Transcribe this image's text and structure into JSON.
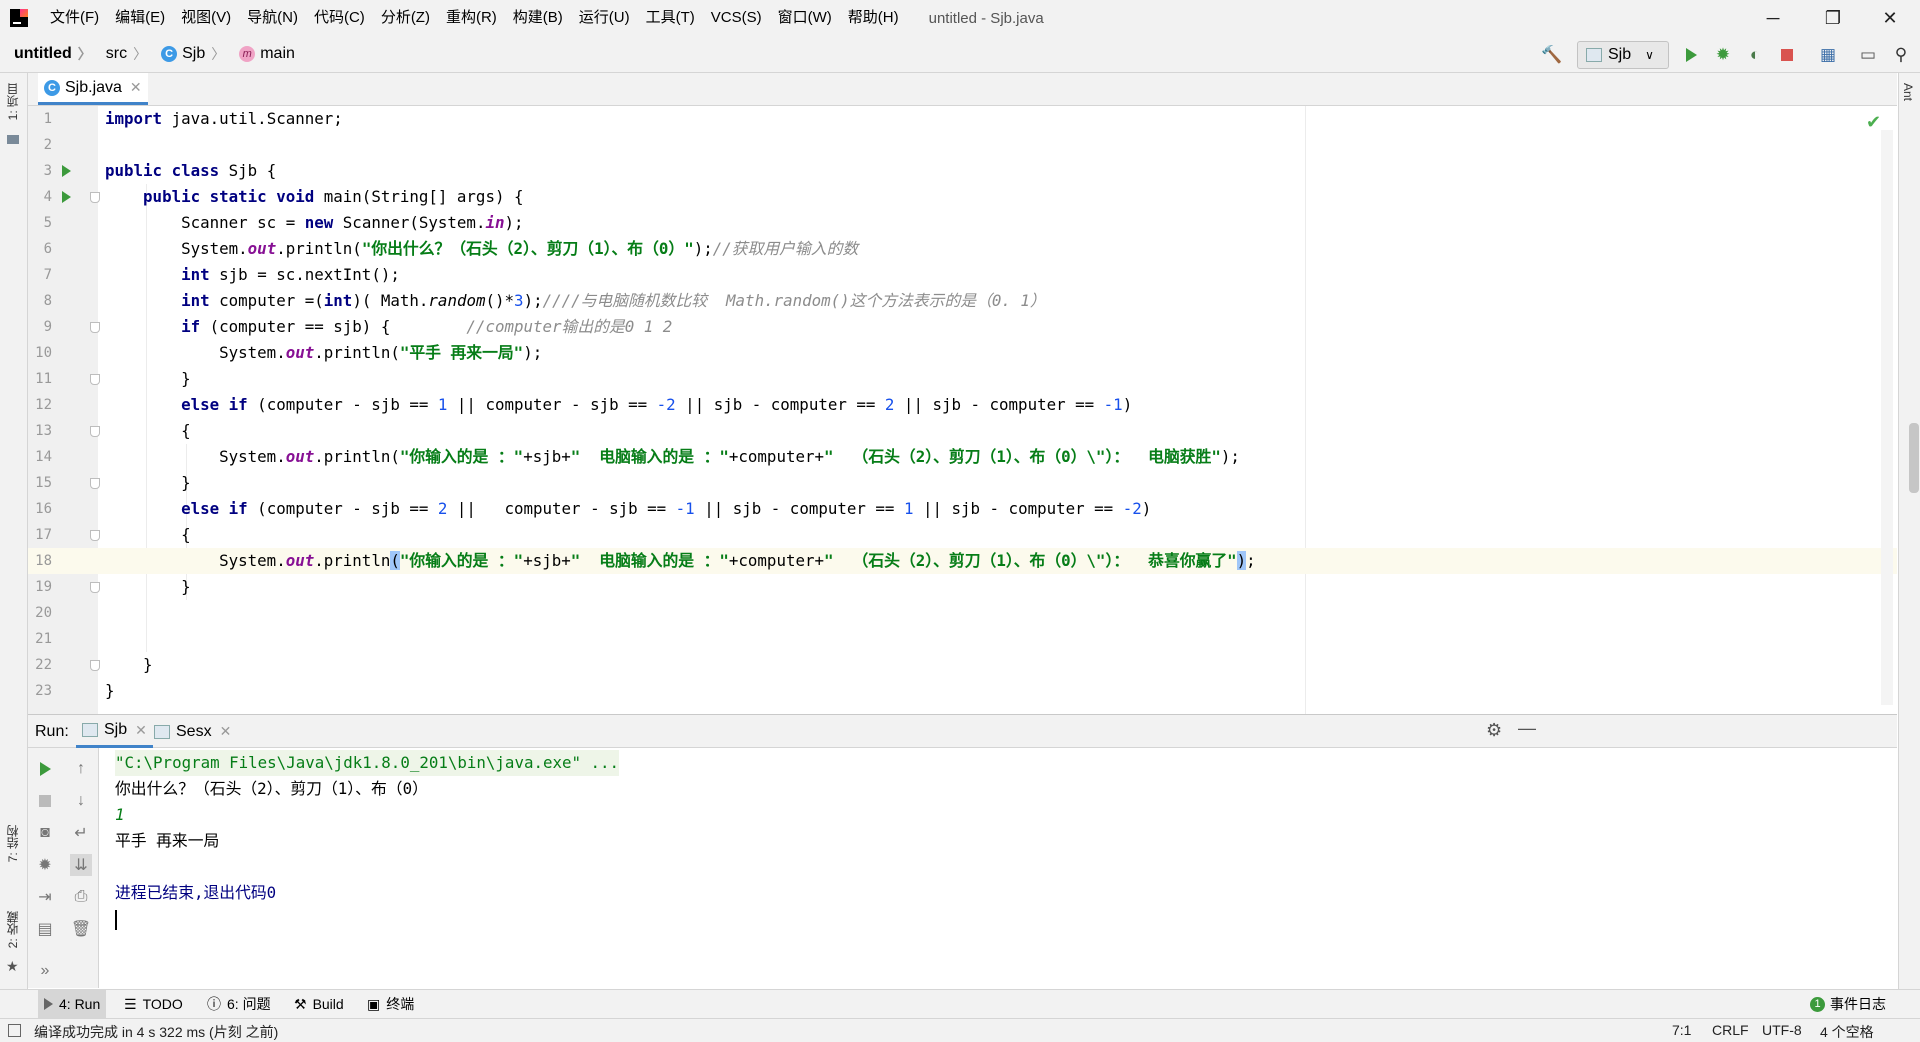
{
  "menubar": {
    "items": [
      "文件(F)",
      "编辑(E)",
      "视图(V)",
      "导航(N)",
      "代码(C)",
      "分析(Z)",
      "重构(R)",
      "构建(B)",
      "运行(U)",
      "工具(T)",
      "VCS(S)",
      "窗口(W)",
      "帮助(H)"
    ],
    "window_title": "untitled - Sjb.java"
  },
  "navbar": {
    "project": "untitled",
    "folder": "src",
    "class_name": "Sjb",
    "method_name": "main",
    "run_config": "Sjb"
  },
  "left_strip": {
    "project_tab": "1: 项目",
    "structure_tab": "7: 结构",
    "favorites_tab": "2: 收藏"
  },
  "right_strip": {
    "ant_tab": "Ant"
  },
  "editor": {
    "tab_name": "Sjb.java",
    "line_numbers": [
      "1",
      "2",
      "3",
      "4",
      "5",
      "6",
      "7",
      "8",
      "9",
      "10",
      "11",
      "12",
      "13",
      "14",
      "15",
      "16",
      "17",
      "18",
      "19",
      "20",
      "21",
      "22",
      "23"
    ]
  },
  "run_panel": {
    "label": "Run:",
    "tabs": [
      "Sjb",
      "Sesx"
    ],
    "console": {
      "command": "\"C:\\Program Files\\Java\\jdk1.8.0_201\\bin\\java.exe\" ...",
      "prompt": "你出什么？（石头（2）、剪刀（1）、布（0）",
      "input": "1",
      "result": "平手 再来一局",
      "exit": "进程已结束,退出代码0"
    }
  },
  "tool_tabs": {
    "run": "4: Run",
    "todo": "TODO",
    "problems": "6: 问题",
    "build": "Build",
    "terminal": "终端",
    "event_log": "事件日志",
    "event_count": "1"
  },
  "statusbar": {
    "message": "编译成功完成 in 4 s 322 ms (片刻 之前)",
    "position": "7:1",
    "line_sep": "CRLF",
    "encoding": "UTF-8",
    "indent": "4 个空格"
  },
  "colors": {
    "keyword": "#000080",
    "string": "#067d17",
    "number": "#1750eb",
    "comment": "#8c8c8c",
    "field": "#871094",
    "accent": "#4083c9"
  }
}
